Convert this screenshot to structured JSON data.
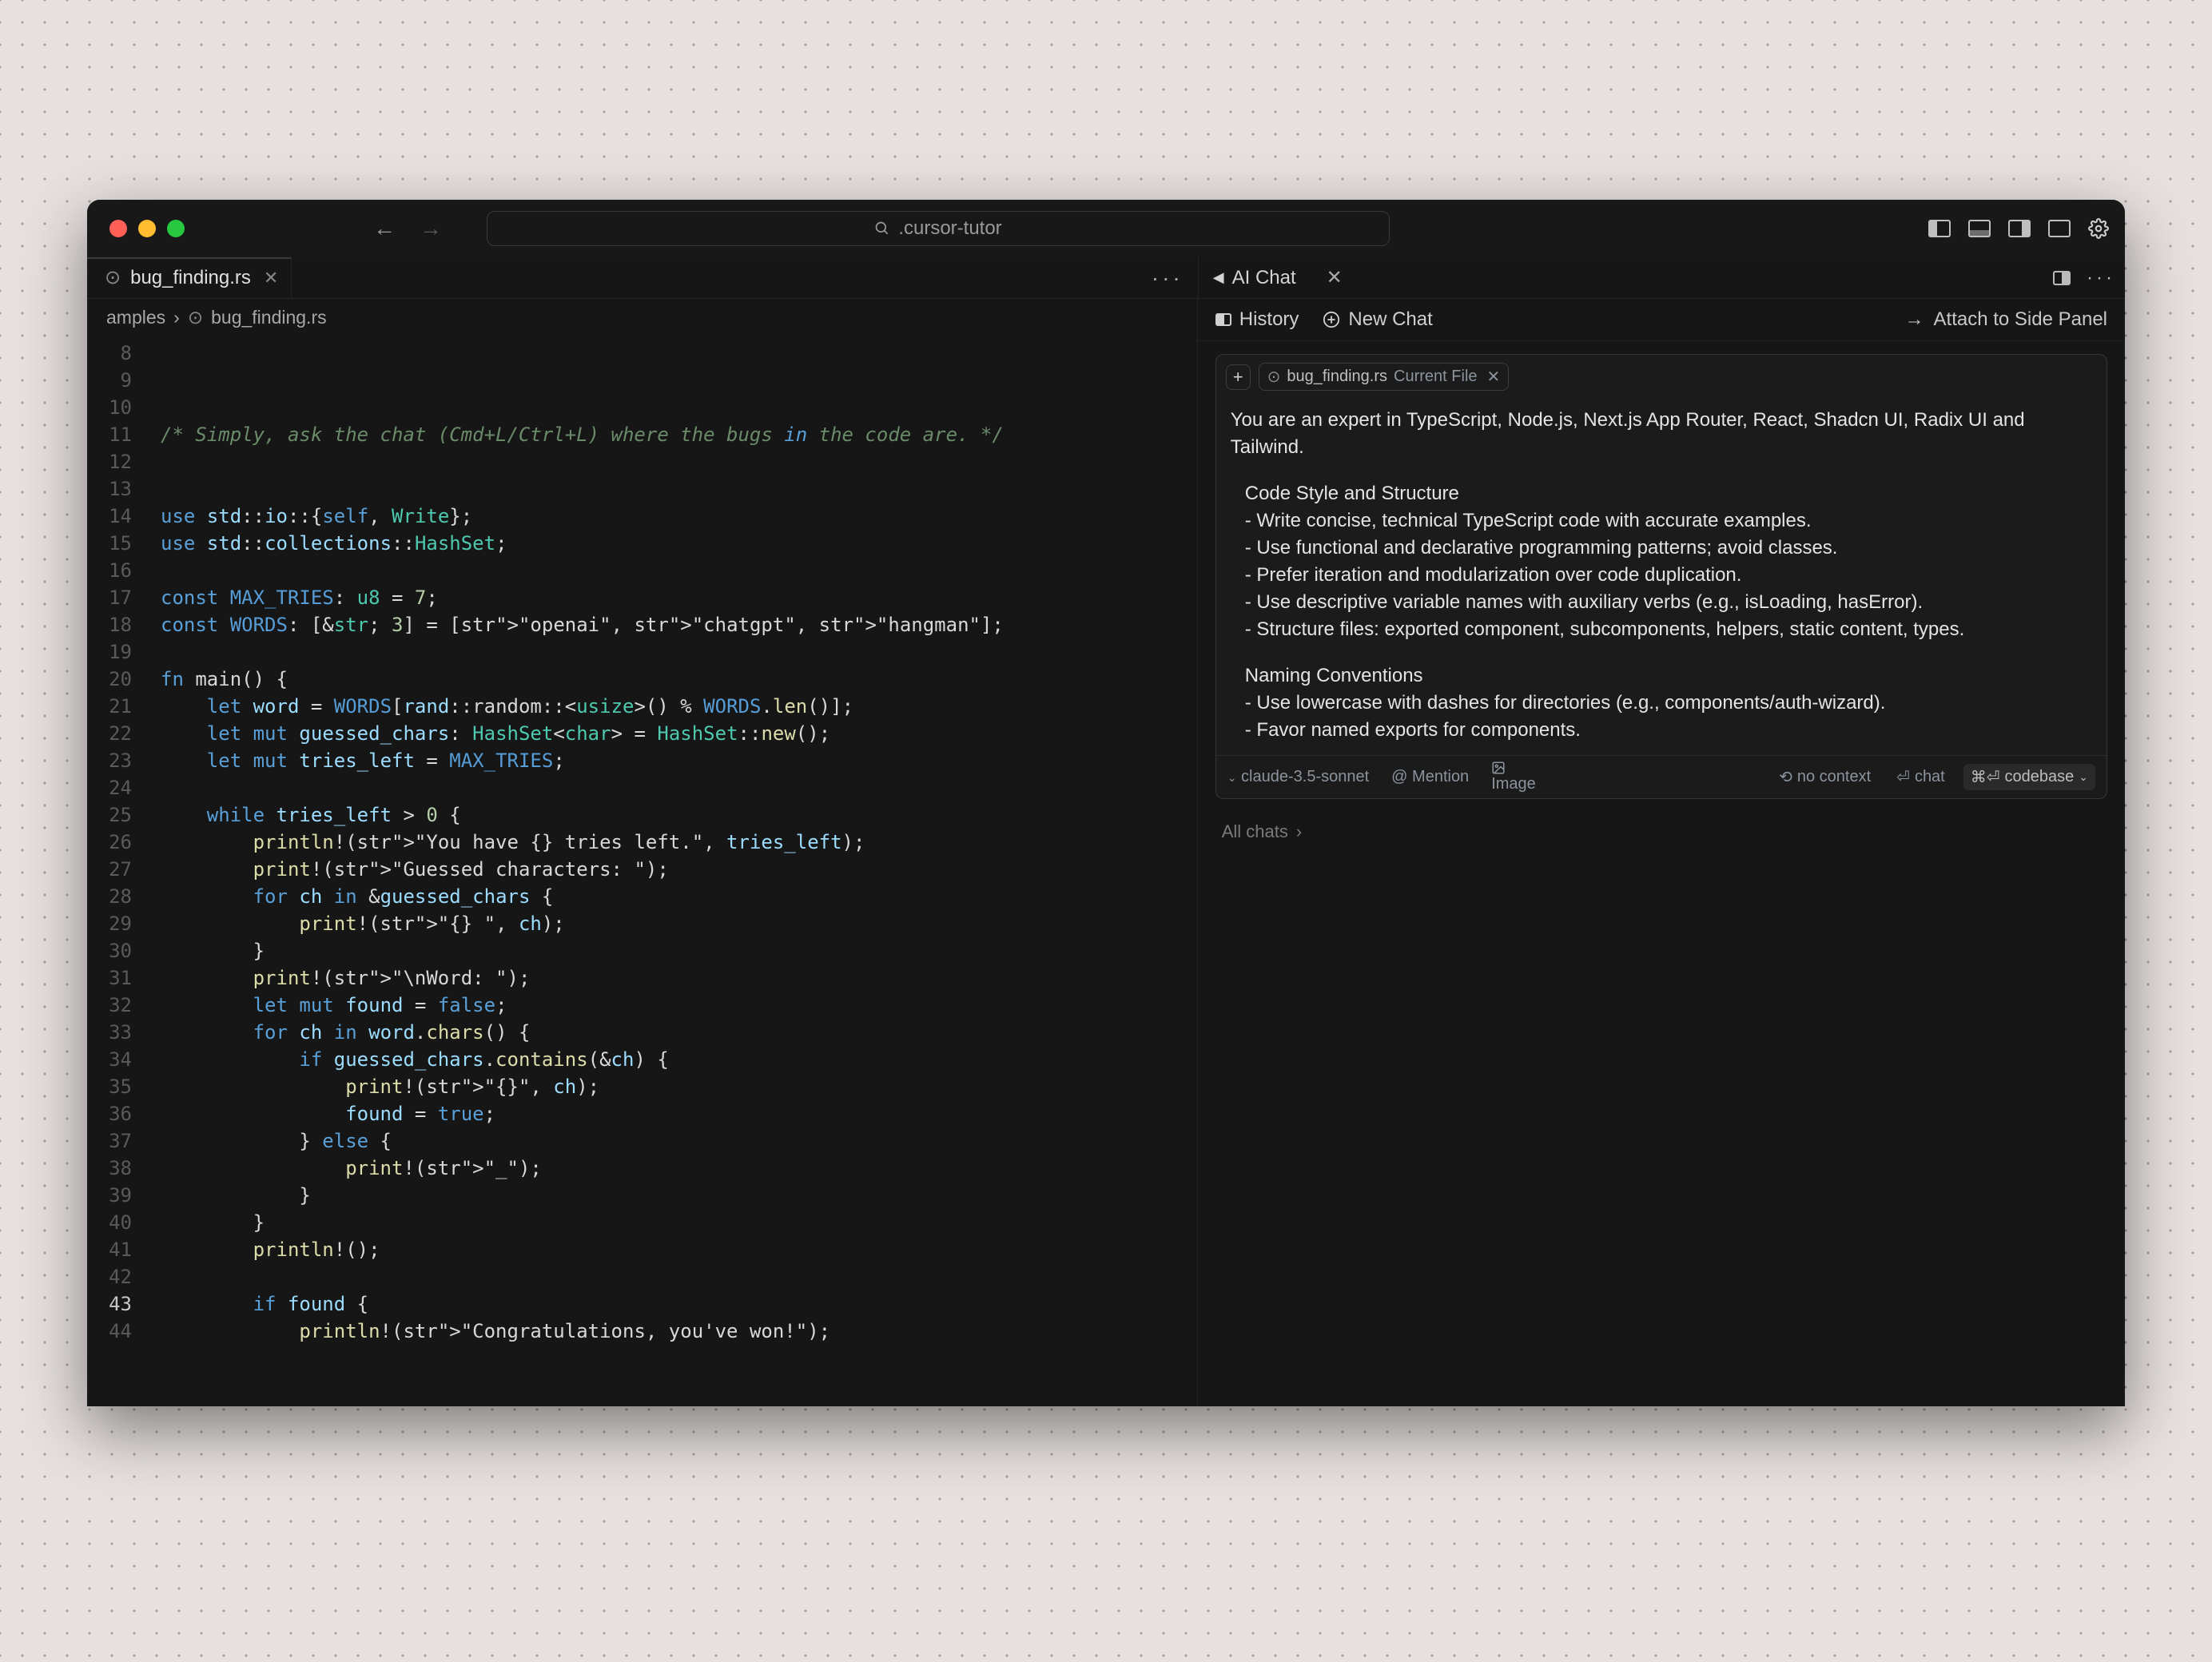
{
  "titlebar": {
    "search_text": ".cursor-tutor",
    "traffic_lights": [
      "close",
      "minimize",
      "zoom"
    ]
  },
  "tabs": {
    "editor_tab_name": "bug_finding.rs",
    "chat_tab_name": "AI Chat"
  },
  "breadcrumb": {
    "segment1": "amples",
    "segment2": "bug_finding.rs"
  },
  "editor": {
    "first_line_no": 8,
    "active_line_no": 43,
    "code_lines": [
      "",
      "",
      "",
      "/* Simply, ask the chat (Cmd+L/Ctrl+L) where the bugs in the code are. */",
      "",
      "",
      "use std::io::{self, Write};",
      "use std::collections::HashSet;",
      "",
      "const MAX_TRIES: u8 = 7;",
      "const WORDS: [&str; 3] = [\"openai\", \"chatgpt\", \"hangman\"];",
      "",
      "fn main() {",
      "    let word = WORDS[rand::random::<usize>() % WORDS.len()];",
      "    let mut guessed_chars: HashSet<char> = HashSet::new();",
      "    let mut tries_left = MAX_TRIES;",
      "",
      "    while tries_left > 0 {",
      "        println!(\"You have {} tries left.\", tries_left);",
      "        print!(\"Guessed characters: \");",
      "        for ch in &guessed_chars {",
      "            print!(\"{} \", ch);",
      "        }",
      "        print!(\"\\nWord: \");",
      "        let mut found = false;",
      "        for ch in word.chars() {",
      "            if guessed_chars.contains(&ch) {",
      "                print!(\"{}\", ch);",
      "                found = true;",
      "            } else {",
      "                print!(\"_\");",
      "            }",
      "        }",
      "        println!();",
      "",
      "        if found {",
      "            println!(\"Congratulations, you've won!\");"
    ]
  },
  "chat": {
    "history_label": "History",
    "new_chat_label": "New Chat",
    "attach_label": "Attach to Side Panel",
    "context_file": "bug_finding.rs",
    "context_tag": "Current File",
    "intro": "You are an expert in TypeScript, Node.js, Next.js App Router, React, Shadcn UI, Radix UI and Tailwind.",
    "section1_title": "Code Style and Structure",
    "section1_items": [
      "Write concise, technical TypeScript code with accurate examples.",
      "Use functional and declarative programming patterns; avoid classes.",
      "Prefer iteration and modularization over code duplication.",
      "Use descriptive variable names with auxiliary verbs (e.g., isLoading, hasError).",
      "Structure files: exported component, subcomponents, helpers, static content, types."
    ],
    "section2_title": "Naming Conventions",
    "section2_items": [
      "Use lowercase with dashes for directories (e.g., components/auth-wizard).",
      "Favor named exports for components."
    ],
    "model": "claude-3.5-sonnet",
    "mention_label": "Mention",
    "image_label": "Image",
    "no_context_label": "no context",
    "chat_btn": "chat",
    "codebase_btn": "codebase",
    "all_chats_label": "All chats"
  }
}
